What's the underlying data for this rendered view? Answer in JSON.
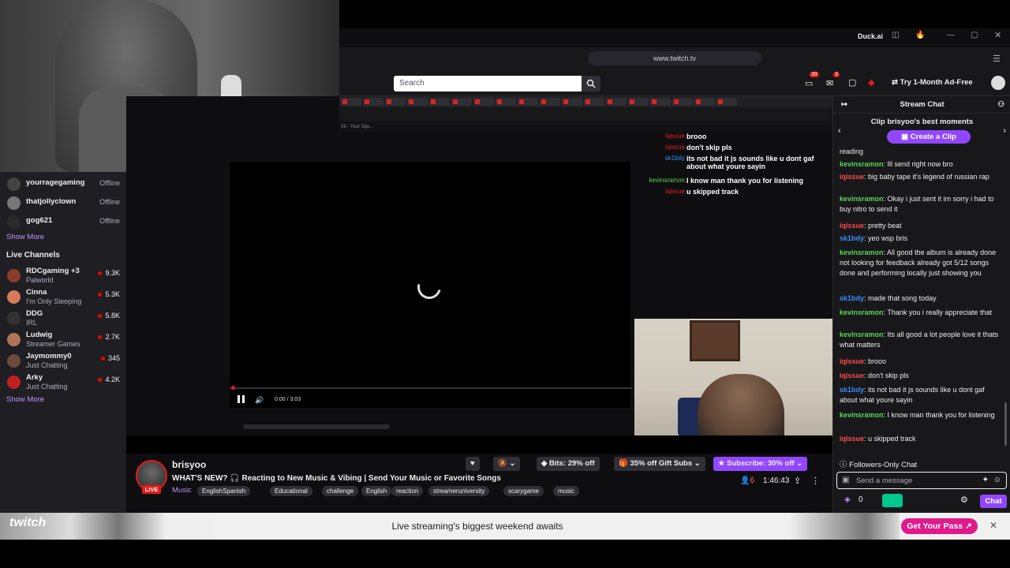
{
  "browser": {
    "url": "www.twitch.tv",
    "brand": "Duck.ai"
  },
  "header": {
    "search_placeholder": "Search",
    "notif_count": "39",
    "inbox_count": "3",
    "cta": "Try 1-Month Ad-Free"
  },
  "sidebar": {
    "followed": [
      {
        "name": "yourragegaming",
        "status": "Offline"
      },
      {
        "name": "thatjollyclown",
        "status": "Offline"
      },
      {
        "name": "gog621",
        "status": "Offline"
      }
    ],
    "show_more": "Show More",
    "live_heading": "Live Channels",
    "live": [
      {
        "name": "RDCgaming +3",
        "category": "Palworld",
        "viewers": "9.3K",
        "color": "#8a3b2b"
      },
      {
        "name": "Cinna",
        "category": "I'm Only Sleeping",
        "viewers": "5.3K",
        "color": "#d97a5b"
      },
      {
        "name": "DDG",
        "category": "IRL",
        "viewers": "5.8K",
        "color": "#333333"
      },
      {
        "name": "Ludwig",
        "category": "Streamer Games",
        "viewers": "2.7K",
        "color": "#b0745a"
      },
      {
        "name": "Jaymommy0",
        "category": "Just Chatting",
        "viewers": "345",
        "color": "#6b4b3b"
      },
      {
        "name": "Arky",
        "category": "Just Chatting",
        "viewers": "4.2K",
        "color": "#c02020"
      }
    ],
    "show_more_2": "Show More"
  },
  "player": {
    "time": "0:00 / 3:03",
    "inner_sub": "29 - Your Spo..."
  },
  "overlay_chat": [
    {
      "user": "iqissue",
      "text": "brooo"
    },
    {
      "user": "iqissue",
      "text": "don't skip pls"
    },
    {
      "user": "sk1bdy",
      "text": "its not bad it js sounds like u dont gaf about what youre sayin"
    },
    {
      "user": "kevinsramon",
      "text": "I know man thank you for listening"
    },
    {
      "user": "iqissue",
      "text": "u skipped track"
    }
  ],
  "channel": {
    "name": "brisyoo",
    "live": "LIVE",
    "title": "WHAT'S NEW? 🎧 Reacting to New Music & Vibing | Send Your Music or Favorite Songs",
    "category": "Music",
    "tags": [
      "EnglishSpanish",
      "Educational",
      "challenge",
      "English",
      "reaction",
      "streameruniversity",
      "scarygame",
      "music"
    ],
    "bits": "Bits: 29% off",
    "gift_subs": "35% off Gift Subs",
    "subscribe": "Subscribe: 30% off",
    "viewers": "6",
    "uptime": "1:46:43"
  },
  "chat": {
    "title": "Stream Chat",
    "clip_title": "Clip brisyoo's best moments",
    "clip_btn": "Create a Clip",
    "messages": [
      {
        "user": "",
        "color": "#efeff1",
        "text": "reading"
      },
      {
        "user": "kevinsramon",
        "color": "#5bd35b",
        "text": "Ill send right now bro"
      },
      {
        "user": "iqissue",
        "color": "#ff4a4a",
        "text": "big baby tape it's legend of russian rap"
      },
      {
        "user": "kevinsramon",
        "color": "#5bd35b",
        "text": "Okay i just sent it im sorry i had to buy nitro to send it"
      },
      {
        "user": "iqissue",
        "color": "#ff4a4a",
        "text": "pretty beat"
      },
      {
        "user": "sk1bdy",
        "color": "#3a8cff",
        "text": "yeo wsp bris"
      },
      {
        "user": "kevinsramon",
        "color": "#5bd35b",
        "text": "All good the album is already done not looking for feedback already got 5/12 songs done and performing locally just showing you"
      },
      {
        "user": "sk1bdy",
        "color": "#3a8cff",
        "text": "made that song today"
      },
      {
        "user": "kevinsramon",
        "color": "#5bd35b",
        "text": "Thank you i really appreciate that"
      },
      {
        "user": "kevinsramon",
        "color": "#5bd35b",
        "text": "Its all good a lot people love it thats what matters"
      },
      {
        "user": "iqissue",
        "color": "#ff4a4a",
        "text": "brooo"
      },
      {
        "user": "iqissue",
        "color": "#ff4a4a",
        "text": "don't skip pls"
      },
      {
        "user": "sk1bdy",
        "color": "#3a8cff",
        "text": "its not bad it js sounds like u dont gaf about what youre sayin"
      },
      {
        "user": "kevinsramon",
        "color": "#5bd35b",
        "text": "I know man thank you for listening"
      },
      {
        "user": "iqissue",
        "color": "#ff4a4a",
        "text": "u skipped track"
      }
    ],
    "followers_only": "Followers-Only Chat",
    "send_placeholder": "Send a message",
    "points": "0",
    "chat_btn": "Chat"
  },
  "banner": {
    "text": "Live streaming's biggest weekend awaits",
    "cta": "Get Your Pass ↗"
  }
}
